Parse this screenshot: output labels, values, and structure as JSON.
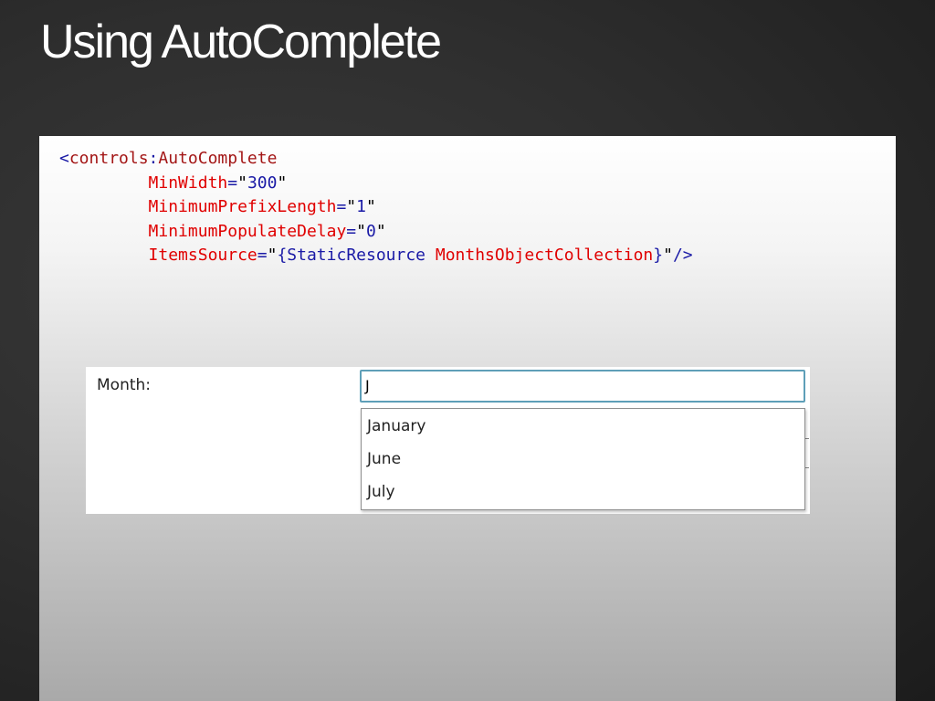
{
  "slide": {
    "title": "Using AutoComplete"
  },
  "code": {
    "lt": "<",
    "prefix": "controls",
    "colon": ":",
    "tag": "AutoComplete",
    "attributes": [
      {
        "name": "MinWidth",
        "value": "300"
      },
      {
        "name": "MinimumPrefixLength",
        "value": "1"
      },
      {
        "name": "MinimumPopulateDelay",
        "value": "0"
      }
    ],
    "items_source": {
      "name": "ItemsSource",
      "open_brace": "{",
      "markup_extension": "StaticResource",
      "resource_key": "MonthsObjectCollection",
      "close_brace": "}",
      "close_tag": "/>"
    }
  },
  "demo": {
    "label": "Month:",
    "input_value": "J",
    "suggestions": [
      "January",
      "June",
      "July"
    ]
  }
}
